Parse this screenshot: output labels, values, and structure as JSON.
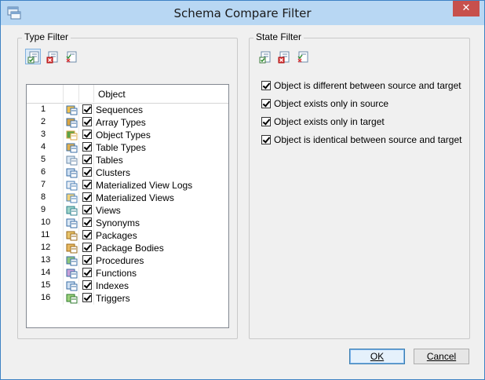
{
  "window": {
    "title": "Schema Compare Filter",
    "close_glyph": "✕"
  },
  "type_filter": {
    "legend": "Type Filter",
    "toolbar": [
      "check-all-icon",
      "uncheck-all-icon",
      "invert-check-icon"
    ],
    "header": {
      "object": "Object"
    },
    "rows": [
      {
        "num": "1",
        "label": "Sequences",
        "icon": "sequence-icon"
      },
      {
        "num": "2",
        "label": "Array Types",
        "icon": "array-type-icon"
      },
      {
        "num": "3",
        "label": "Object Types",
        "icon": "object-type-icon"
      },
      {
        "num": "4",
        "label": "Table Types",
        "icon": "table-type-icon"
      },
      {
        "num": "5",
        "label": "Tables",
        "icon": "table-icon"
      },
      {
        "num": "6",
        "label": "Clusters",
        "icon": "cluster-icon"
      },
      {
        "num": "7",
        "label": "Materialized View Logs",
        "icon": "mview-log-icon"
      },
      {
        "num": "8",
        "label": "Materialized Views",
        "icon": "mview-icon"
      },
      {
        "num": "9",
        "label": "Views",
        "icon": "view-icon"
      },
      {
        "num": "10",
        "label": "Synonyms",
        "icon": "synonym-icon"
      },
      {
        "num": "11",
        "label": "Packages",
        "icon": "package-icon"
      },
      {
        "num": "12",
        "label": "Package Bodies",
        "icon": "package-body-icon"
      },
      {
        "num": "13",
        "label": "Procedures",
        "icon": "procedure-icon"
      },
      {
        "num": "14",
        "label": "Functions",
        "icon": "function-icon"
      },
      {
        "num": "15",
        "label": "Indexes",
        "icon": "index-icon"
      },
      {
        "num": "16",
        "label": "Triggers",
        "icon": "trigger-icon"
      }
    ]
  },
  "state_filter": {
    "legend": "State Filter",
    "toolbar": [
      "check-all-icon",
      "uncheck-all-icon",
      "invert-check-icon"
    ],
    "items": [
      {
        "label": "Object is different between source and target",
        "checked": true
      },
      {
        "label": "Object exists only in source",
        "checked": true
      },
      {
        "label": "Object exists only in target",
        "checked": true
      },
      {
        "label": "Object is identical between source and target",
        "checked": true
      }
    ]
  },
  "buttons": {
    "ok_label": "OK",
    "cancel_label": "Cancel"
  },
  "colors": {
    "title_bar": "#b8d7f3",
    "close_button": "#c7504c",
    "window_border": "#3e82c4",
    "accent": "#7fb0de"
  }
}
